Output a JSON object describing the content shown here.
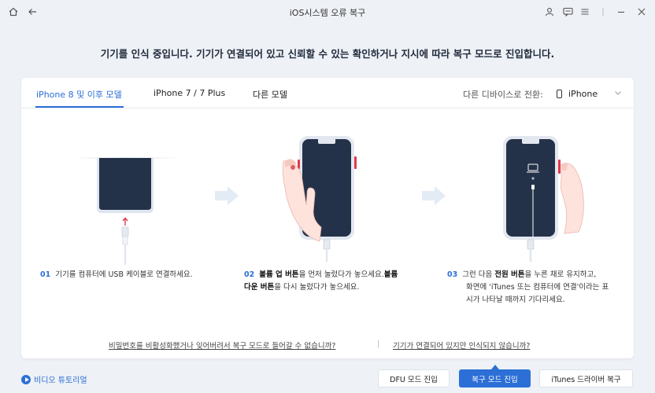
{
  "app": {
    "title": "iOS시스템 오류 복구"
  },
  "headline": "기기를 인식 중입니다. 기기가 연결되어 있고 신뢰할 수 있는 확인하거나 지시에 따라 복구 모드로 진입합니다.",
  "tabs": [
    {
      "label": "iPhone 8 및 이후 모델",
      "active": true
    },
    {
      "label": "iPhone 7 / 7 Plus",
      "active": false
    },
    {
      "label": "다른 모델",
      "active": false
    }
  ],
  "device_switch": {
    "label": "다른 디바이스로 전환:",
    "selected": "iPhone"
  },
  "steps": [
    {
      "num": "01",
      "text": "기기를 컴퓨터에 USB 케이블로 연결하세요."
    },
    {
      "num": "02",
      "bold1": "볼륨 업 버튼",
      "text1": "을 먼저 눌렀다가 놓으세요.",
      "bold2": "볼륨",
      "bold3": "다운 버튼",
      "text2": "을 다시 눌렀다가 놓으세요."
    },
    {
      "num": "03",
      "text1": "그런 다음 ",
      "bold1": "전원 버튼",
      "text2": "을 누른 채로 유지하고,",
      "line2": "화면에 'iTunes 또는 컴퓨터에 연결'이라는 표",
      "line3": "시가 나타날 때까지 기다리세요."
    }
  ],
  "help_links": {
    "left": "비밀번호를 비활성화했거나 잊어버려서 복구 모드로 들어갈 수 없습니까?",
    "right": "기기가 연결되어 있지만 인식되지 않습니까?"
  },
  "bottom": {
    "video_label": "비디오 튜토리얼",
    "dfu_label": "DFU 모드 진입",
    "recovery_label": "복구 모드 진입",
    "itunes_label": "iTunes 드라이버 복구"
  },
  "colors": {
    "accent": "#2c6fd6",
    "phone_screen": "#243249",
    "hand": "#fde3dc"
  }
}
